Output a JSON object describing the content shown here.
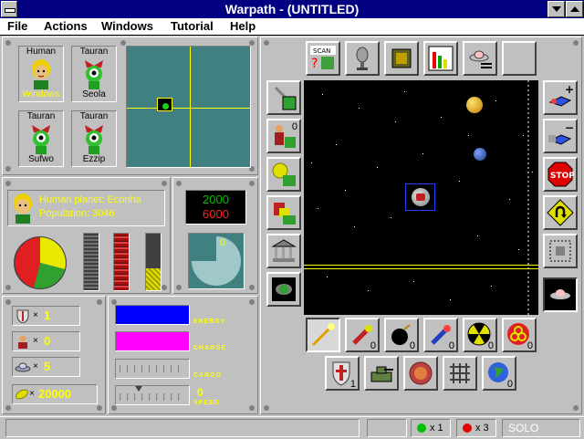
{
  "window": {
    "title": "Warpath - (UNTITLED)"
  },
  "menu": [
    "File",
    "Actions",
    "Windows",
    "Tutorial",
    "Help"
  ],
  "races": [
    {
      "type": "Human",
      "name": "Windows",
      "selected": true
    },
    {
      "type": "Tauran",
      "name": "Seola"
    },
    {
      "type": "Tauran",
      "name": "Sufwo"
    },
    {
      "type": "Tauran",
      "name": "Ezzip"
    }
  ],
  "planet": {
    "line1": "Human planet: Econha",
    "line2": "Population: 3046"
  },
  "scores": {
    "top": "2000",
    "bottom": "6000",
    "green_color": "#00c000",
    "red_color": "#ff2020"
  },
  "pie_label": "0",
  "resources": [
    {
      "icon": "shield-icon",
      "mult": "×",
      "value": "1"
    },
    {
      "icon": "person-icon",
      "mult": "×",
      "value": "0"
    },
    {
      "icon": "ship-icon",
      "mult": "×",
      "value": "5"
    },
    {
      "icon": "credits-icon",
      "mult": "×",
      "value": "20000"
    }
  ],
  "gauges": {
    "energy": {
      "label": "ENERGY",
      "level": 1.0,
      "color": "#0000ff"
    },
    "charge": {
      "label": "CHARGE",
      "level": 1.0,
      "color": "#ff00ff"
    },
    "cargo": {
      "label": "CARGO",
      "level": 0
    },
    "speed": {
      "label": "SPEED",
      "value": "0"
    }
  },
  "toolbar_top": [
    "scan-icon",
    "microphone-icon",
    "chip-icon",
    "bar-chart-icon",
    "ufo-report-icon",
    "blank"
  ],
  "scan_label": "SCAN",
  "left_tools": [
    {
      "icon": "build-icon",
      "count": ""
    },
    {
      "icon": "colonist-icon",
      "count": "0"
    },
    {
      "icon": "money-icon",
      "count": ""
    },
    {
      "icon": "cargo-icon",
      "count": ""
    },
    {
      "icon": "bank-icon",
      "count": ""
    },
    {
      "icon": "planet-view-icon",
      "count": ""
    }
  ],
  "right_tools": [
    "zoom-in-icon",
    "zoom-out-icon",
    "stop-icon",
    "u-turn-icon",
    "grid-icon",
    "ufo-icon"
  ],
  "weapons": [
    {
      "icon": "laser-icon",
      "count": ""
    },
    {
      "icon": "torpedo-icon",
      "count": "0"
    },
    {
      "icon": "bomb-icon",
      "count": "0"
    },
    {
      "icon": "missile-icon",
      "count": "0"
    },
    {
      "icon": "nuke-icon",
      "count": "0"
    },
    {
      "icon": "biohazard-icon",
      "count": "0"
    }
  ],
  "defenses": [
    {
      "icon": "shield-knight-icon",
      "count": "1"
    },
    {
      "icon": "tank-icon",
      "count": ""
    },
    {
      "icon": "mine-icon",
      "count": ""
    },
    {
      "icon": "grid-mine-icon",
      "count": ""
    },
    {
      "icon": "globe-icon",
      "count": "0"
    }
  ],
  "status": {
    "green_count": "x 1",
    "red_count": "x 3",
    "mode": "SOLO",
    "green_color": "#00c000",
    "red_color": "#e00000"
  }
}
